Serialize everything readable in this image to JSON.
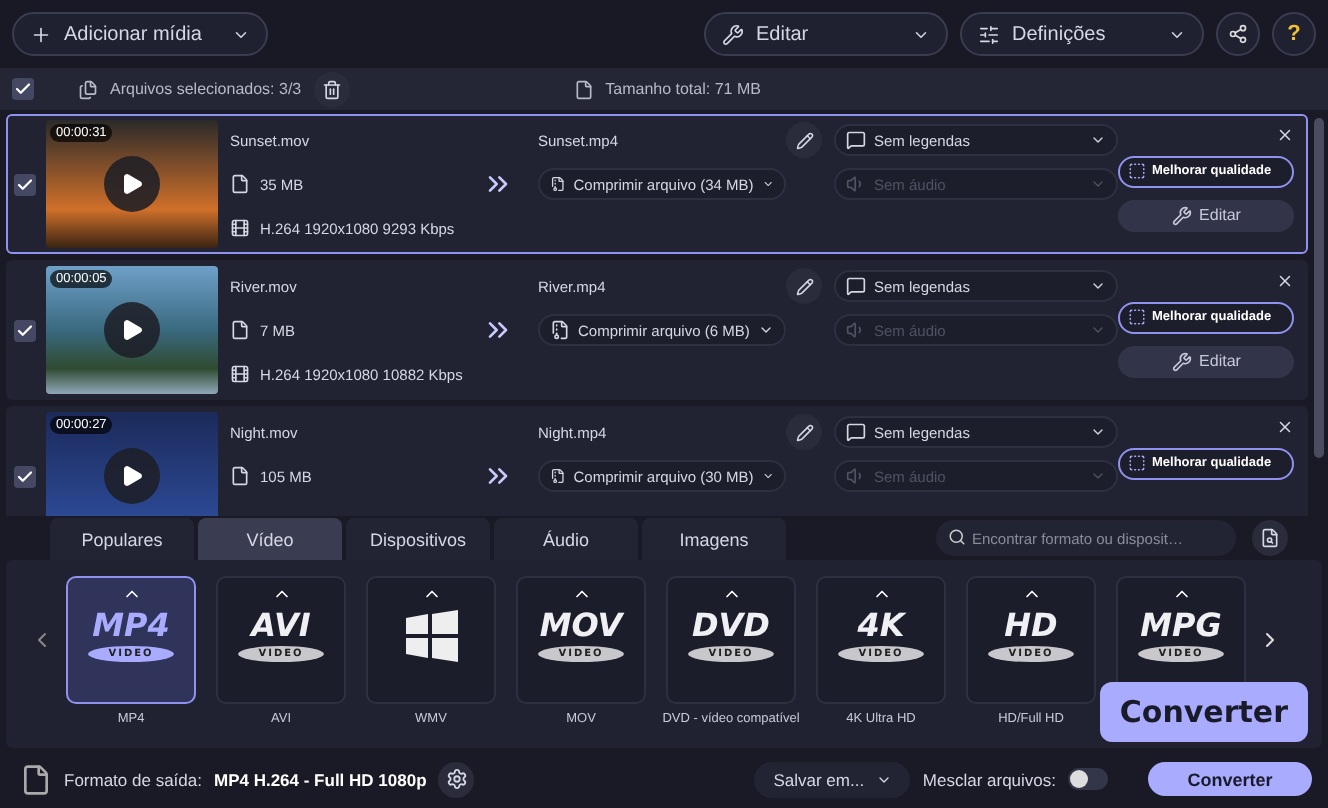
{
  "toolbar": {
    "add_media": "Adicionar mídia",
    "edit": "Editar",
    "settings": "Definições",
    "help": "?"
  },
  "selection_bar": {
    "checked": true,
    "selected_files": "Arquivos selecionados: 3/3",
    "total_size": "Tamanho total: 71 MB"
  },
  "files": [
    {
      "selected": true,
      "checked": true,
      "duration": "00:00:31",
      "name": "Sunset.mov",
      "size": "35 MB",
      "codec": "H.264 1920x1080 9293 Kbps",
      "output_name": "Sunset.mp4",
      "compression": "Comprimir arquivo (34 MB)",
      "subtitles": "Sem legendas",
      "audio": "Sem áudio",
      "audio_disabled": true,
      "enhance": "Melhorar qualidade",
      "edit": "Editar"
    },
    {
      "selected": false,
      "checked": true,
      "duration": "00:00:05",
      "name": "River.mov",
      "size": "7 MB",
      "codec": "H.264 1920x1080 10882 Kbps",
      "output_name": "River.mp4",
      "compression": "Comprimir arquivo (6 MB)",
      "subtitles": "Sem legendas",
      "audio": "Sem áudio",
      "audio_disabled": true,
      "enhance": "Melhorar qualidade",
      "edit": "Editar"
    },
    {
      "selected": false,
      "checked": true,
      "duration": "00:00:27",
      "name": "Night.mov",
      "size": "105 MB",
      "output_name": "Night.mp4",
      "compression": "Comprimir arquivo (30 MB)",
      "subtitles": "Sem legendas",
      "audio": "Sem áudio",
      "audio_disabled": true,
      "enhance": "Melhorar qualidade"
    }
  ],
  "format_tabs": [
    {
      "label": "Populares",
      "selected": false
    },
    {
      "label": "Vídeo",
      "selected": true
    },
    {
      "label": "Dispositivos",
      "selected": false
    },
    {
      "label": "Áudio",
      "selected": false
    },
    {
      "label": "Imagens",
      "selected": false
    }
  ],
  "search": {
    "placeholder": "Encontrar formato ou disposit…"
  },
  "formats": [
    {
      "kind": "logo",
      "logo": "MP4",
      "sub": "VIDEO",
      "label": "MP4",
      "selected": true
    },
    {
      "kind": "logo",
      "logo": "AVI",
      "sub": "VIDEO",
      "label": "AVI",
      "selected": false
    },
    {
      "kind": "windows",
      "label": "WMV",
      "selected": false
    },
    {
      "kind": "logo",
      "logo": "MOV",
      "sub": "VIDEO",
      "label": "MOV",
      "selected": false
    },
    {
      "kind": "logo",
      "logo": "DVD",
      "sub": "VIDEO",
      "label": "DVD - vídeo compatível",
      "selected": false
    },
    {
      "kind": "logo",
      "logo": "4K",
      "sub": "VIDEO",
      "label": "4K Ultra HD",
      "selected": false
    },
    {
      "kind": "logo",
      "logo": "HD",
      "sub": "VIDEO",
      "label": "HD/Full HD",
      "selected": false
    },
    {
      "kind": "logo",
      "logo": "MPG",
      "sub": "VIDEO",
      "selected": false
    }
  ],
  "bottom": {
    "output_label": "Formato de saída:",
    "output_value": "MP4 H.264 - Full HD 1080p",
    "save": "Salvar em...",
    "merge": "Mesclar arquivos:",
    "merge_on": false,
    "convert": "Converter"
  },
  "tooltip": "Converter"
}
